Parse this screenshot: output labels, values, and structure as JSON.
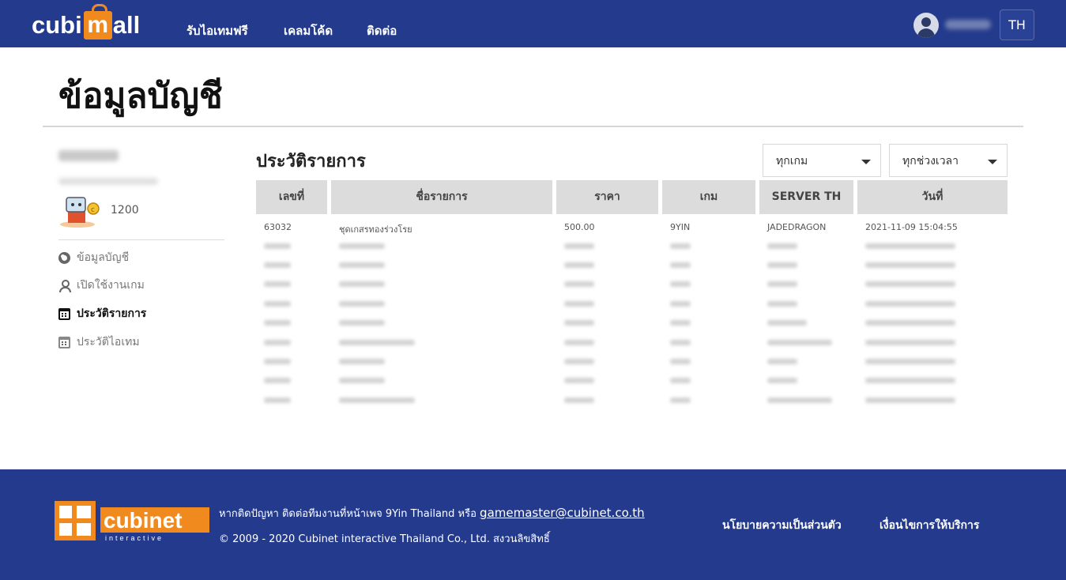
{
  "header": {
    "logo_left": "cubi",
    "logo_bag_letter": "m",
    "logo_right": "all",
    "nav": [
      "รับไอเทมฟรี",
      "เคลมโค้ด",
      "ติดต่อ"
    ],
    "lang": "TH"
  },
  "page": {
    "title": "ข้อมูลบัญชี"
  },
  "sidebar": {
    "coins": "1200",
    "items": [
      {
        "label": "ข้อมูลบัญชี",
        "icon": "gear-icon"
      },
      {
        "label": "เปิดใช้งานเกม",
        "icon": "user-icon"
      },
      {
        "label": "ประวัติรายการ",
        "icon": "calendar-icon"
      },
      {
        "label": "ประวัติไอเทม",
        "icon": "calendar-icon"
      }
    ]
  },
  "history": {
    "title": "ประวัติรายการ",
    "filter_game": "ทุกเกม",
    "filter_time": "ทุกช่วงเวลา",
    "columns": [
      "เลขที่",
      "ชื่อรายการ",
      "ราคา",
      "เกม",
      "SERVER TH",
      "วันที่"
    ],
    "rows": [
      [
        "63032",
        "ชุดเกสรทองร่วงโรย",
        "500.00",
        "9YIN",
        "JADEDRAGON",
        "2021-11-09 15:04:55"
      ]
    ]
  },
  "footer": {
    "contact_text": "หากติดปัญหา ติดต่อทีมงานที่หน้าเพจ 9Yin Thailand หรือ",
    "email": "gamemaster@cubinet.co.th",
    "copyright": "© 2009 - 2020 Cubinet interactive Thailand Co., Ltd. สงวนลิขสิทธิ์",
    "links": [
      "นโยบายความเป็นส่วนตัว",
      "เงื่อนไขการให้บริการ"
    ],
    "logo_main": "cubinet",
    "logo_sub": "interactive"
  },
  "colors": {
    "header_bg": "#243a8c",
    "accent": "#f08a1f",
    "table_header_bg": "#dcdcdc"
  }
}
